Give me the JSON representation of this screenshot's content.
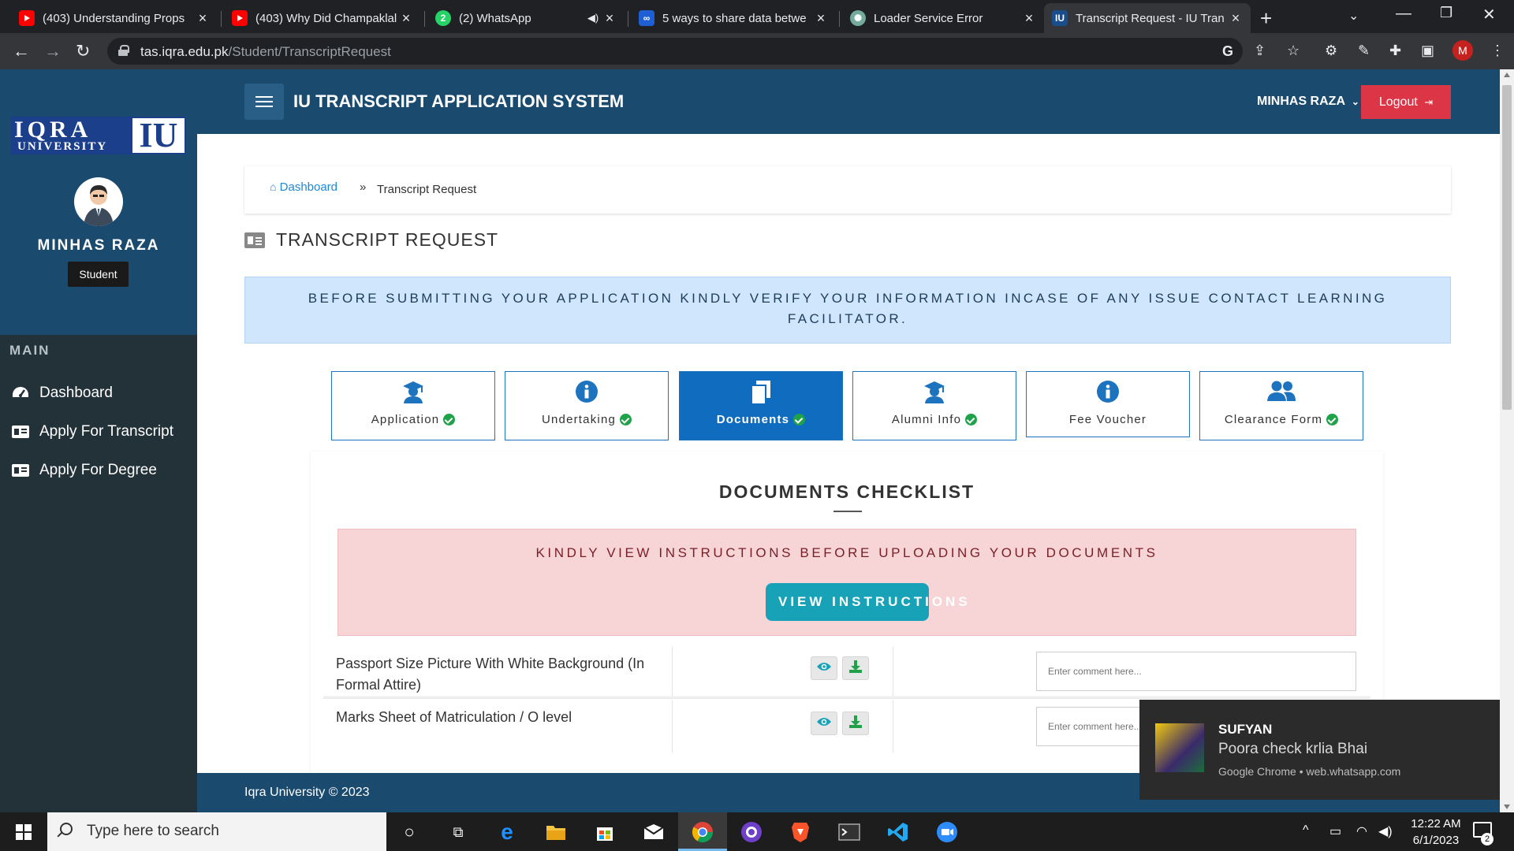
{
  "browser": {
    "tabs": [
      {
        "title": "(403) Understanding Props",
        "icon": "youtube-icon"
      },
      {
        "title": "(403) Why Did Champaklal",
        "icon": "youtube-icon"
      },
      {
        "title": "(2) WhatsApp",
        "icon": "whatsapp-icon",
        "badge": "2"
      },
      {
        "title": "5 ways to share data betwe",
        "icon": "codeproject-icon"
      },
      {
        "title": "Loader Service Error",
        "icon": "chatgpt-icon"
      },
      {
        "title": "Transcript Request - IU Tran",
        "icon": "iu-icon",
        "active": true
      }
    ],
    "url_host": "tas.iqra.edu.pk",
    "url_path": "/Student/TranscriptRequest",
    "profile_initial": "M"
  },
  "sidebar": {
    "logo": {
      "top": "IQRA",
      "bottom": "UNIVERSITY",
      "mark": "IU"
    },
    "user_name": "MINHAS RAZA",
    "role": "Student",
    "menu_heading": "MAIN",
    "menu": [
      {
        "label": "Dashboard",
        "icon": "dashboard-icon"
      },
      {
        "label": "Apply For Transcript",
        "icon": "id-card-icon"
      },
      {
        "label": "Apply For Degree",
        "icon": "id-card-icon"
      }
    ]
  },
  "header": {
    "title": "IU TRANSCRIPT APPLICATION SYSTEM",
    "user": "MINHAS RAZA",
    "logout": "Logout"
  },
  "breadcrumb": {
    "home": "Dashboard",
    "separator": "»",
    "current": "Transcript Request"
  },
  "page_title": "TRANSCRIPT REQUEST",
  "notice": "BEFORE SUBMITTING YOUR APPLICATION KINDLY VERIFY YOUR INFORMATION INCASE OF ANY ISSUE CONTACT LEARNING FACILITATOR.",
  "steps": [
    {
      "label": "Application",
      "icon": "graduate-icon",
      "complete": true
    },
    {
      "label": "Undertaking",
      "icon": "info-icon",
      "complete": true
    },
    {
      "label": "Documents",
      "icon": "documents-icon",
      "complete": true,
      "active": true
    },
    {
      "label": "Alumni Info",
      "icon": "graduate-icon",
      "complete": true
    },
    {
      "label": "Fee Voucher",
      "icon": "info-icon",
      "complete": false
    },
    {
      "label": "Clearance Form",
      "icon": "users-icon",
      "complete": true
    }
  ],
  "checklist": {
    "title": "DOCUMENTS CHECKLIST",
    "warning": "KINDLY VIEW INSTRUCTIONS BEFORE UPLOADING YOUR DOCUMENTS",
    "view_button": "VIEW INSTRUCTIONS",
    "documents": [
      {
        "name": "Passport Size Picture With White Background (In Formal Attire)",
        "comment_placeholder": "Enter comment here..."
      },
      {
        "name": "Marks Sheet of Matriculation / O level",
        "comment_placeholder": "Enter comment here..."
      }
    ]
  },
  "footer": "Iqra University © 2023",
  "toast": {
    "sender": "SUFYAN",
    "message": "Poora check krlia Bhai",
    "source": "Google Chrome • web.whatsapp.com"
  },
  "taskbar": {
    "search_placeholder": "Type here to search",
    "time": "12:22 AM",
    "date": "6/1/2023",
    "notifications": "2"
  },
  "colors": {
    "primary_dark": "#1b4a6f",
    "sidebar": "#233238",
    "active_step": "#0f6cbf",
    "logout": "#dc3545",
    "info_button": "#17a2b8",
    "success": "#1fa24a"
  }
}
